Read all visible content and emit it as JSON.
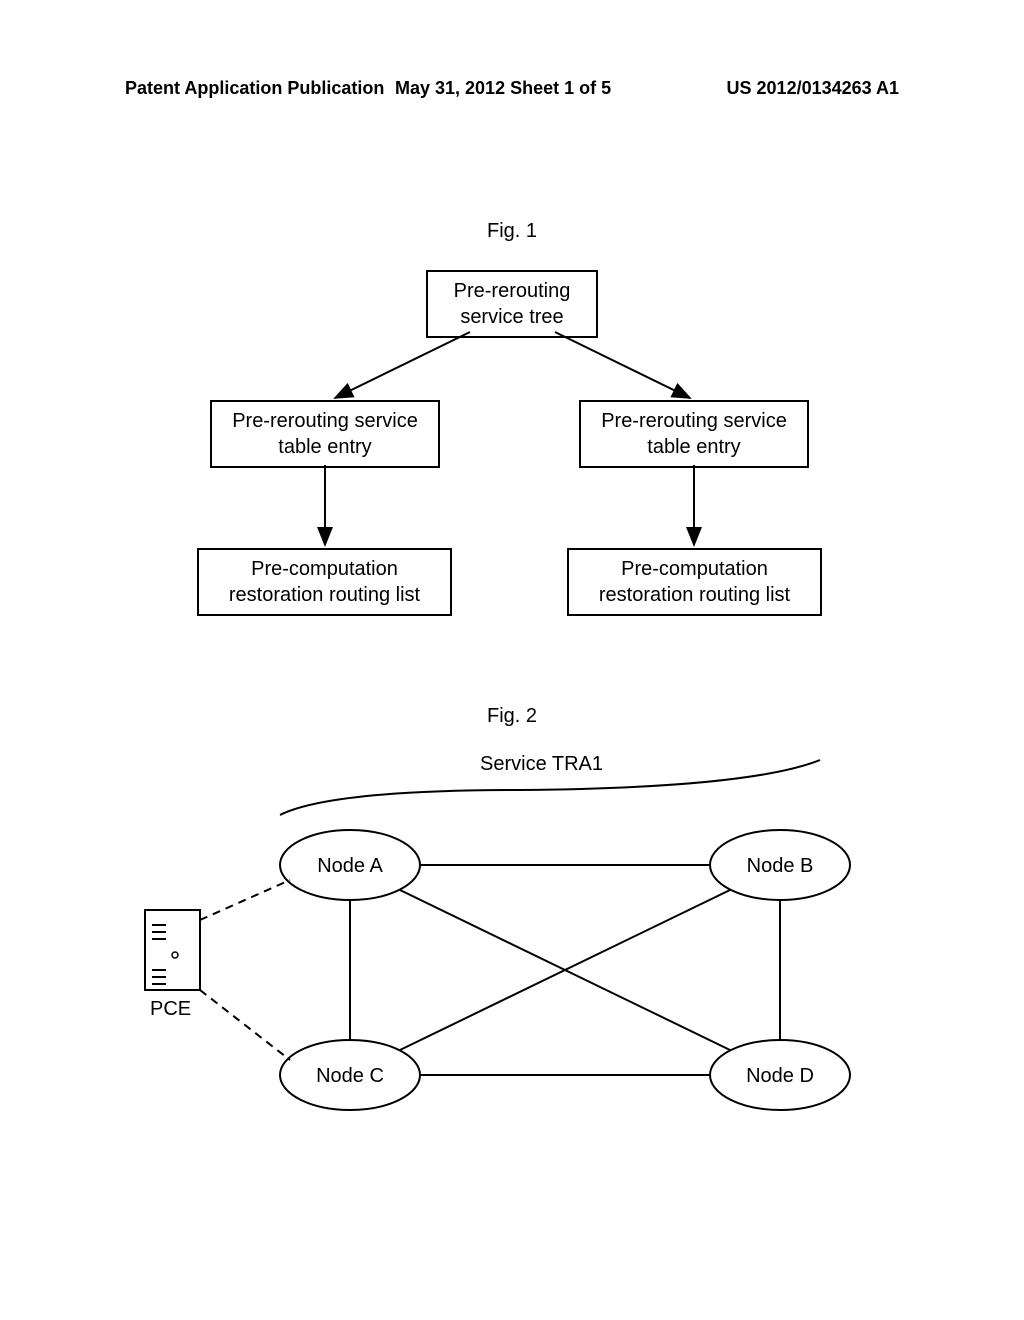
{
  "header": {
    "left": "Patent Application Publication",
    "mid": "May 31, 2012  Sheet 1 of 5",
    "right": "US 2012/0134263 A1"
  },
  "fig1": {
    "label": "Fig. 1",
    "root": "Pre-rerouting service tree",
    "entry_left": "Pre-rerouting service table entry",
    "entry_right": "Pre-rerouting service table entry",
    "list_left": "Pre-computation restoration routing list",
    "list_right": "Pre-computation restoration routing list"
  },
  "fig2": {
    "label": "Fig. 2",
    "service": "Service TRA1",
    "nodes": {
      "a": "Node A",
      "b": "Node B",
      "c": "Node C",
      "d": "Node D"
    },
    "pce": "PCE"
  }
}
